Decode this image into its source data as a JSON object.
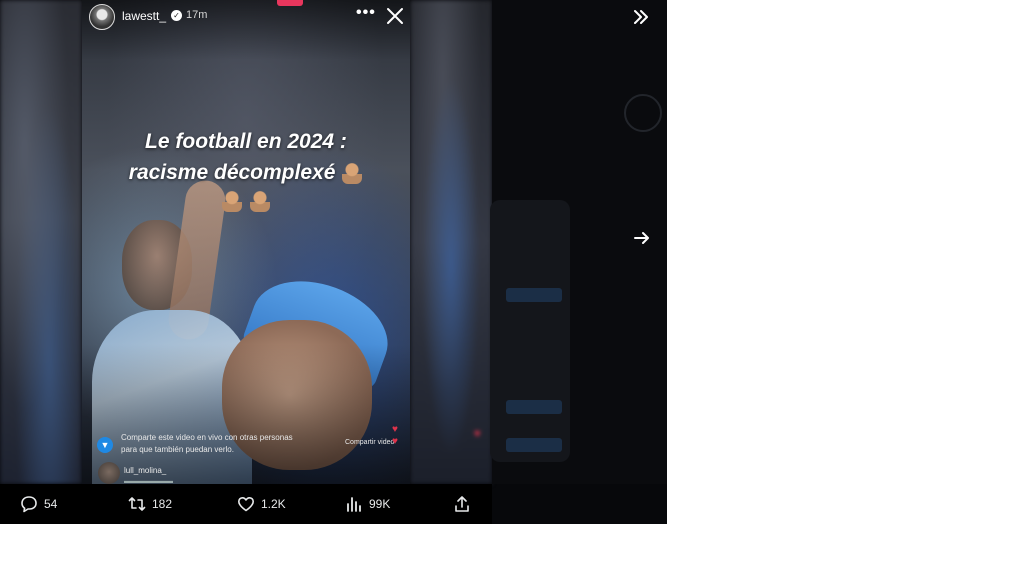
{
  "story": {
    "username": "lawestt_",
    "verified_badge": "✓",
    "time": "17m",
    "more_label": "•••",
    "caption_line1": "Le football en 2024 :",
    "caption_line2": "racisme décomplexé"
  },
  "live_overlay": {
    "share_prompt_line1": "Comparte este video en vivo con otras personas",
    "share_prompt_line2": "para que también puedan verlo.",
    "share_button": "Compartir video",
    "commenter": "lull_molina_"
  },
  "actions": {
    "replies": "54",
    "reposts": "182",
    "likes": "1.2K",
    "views": "99K"
  },
  "colors": {
    "accent_red": "#e8365d",
    "live_blue": "#1f89e4",
    "bar_bg": "#000000"
  }
}
